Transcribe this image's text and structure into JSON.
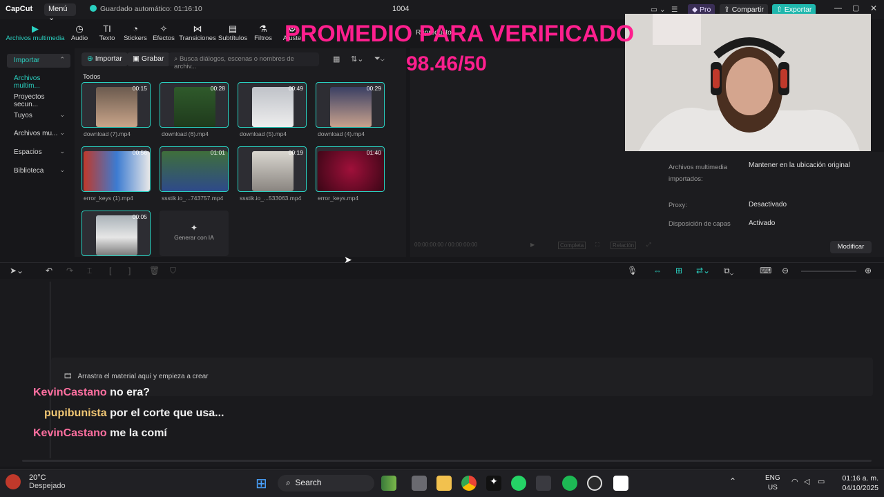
{
  "app": {
    "logo": "CapCut",
    "menu_label": "Menú",
    "autosave": "Guardado automático: 01:16:10",
    "project_name": "1004",
    "pro_label": "Pro",
    "share_label": "Compartir",
    "export_label": "Exportar"
  },
  "toolbar": {
    "items": [
      {
        "label": "Archivos multimedia",
        "icon": "media-icon"
      },
      {
        "label": "Audio",
        "icon": "audio-icon"
      },
      {
        "label": "Texto",
        "icon": "text-icon"
      },
      {
        "label": "Stickers",
        "icon": "sticker-icon"
      },
      {
        "label": "Efectos",
        "icon": "effects-icon"
      },
      {
        "label": "Transiciones",
        "icon": "transitions-icon"
      },
      {
        "label": "Subtítulos",
        "icon": "captions-icon"
      },
      {
        "label": "Filtros",
        "icon": "filters-icon"
      },
      {
        "label": "Ajuste",
        "icon": "adjust-icon"
      }
    ]
  },
  "leftnav": {
    "items": [
      {
        "label": "Importar"
      },
      {
        "label": "Archivos multim..."
      },
      {
        "label": "Proyectos secun..."
      },
      {
        "label": "Tuyos"
      },
      {
        "label": "Archivos mu..."
      },
      {
        "label": "Espacios"
      },
      {
        "label": "Biblioteca"
      }
    ]
  },
  "media": {
    "import_label": "Importar",
    "record_label": "Grabar",
    "search_placeholder": "Busca diálogos, escenas o nombres de archiv...",
    "section_label": "Todos",
    "generate_label": "Generar con IA",
    "clips": [
      {
        "name": "download (7).mp4",
        "duration": "00:15"
      },
      {
        "name": "download (6).mp4",
        "duration": "00:28"
      },
      {
        "name": "download (5).mp4",
        "duration": "00:49"
      },
      {
        "name": "download (4).mp4",
        "duration": "00:29"
      },
      {
        "name": "error_keys (1).mp4",
        "duration": "00:56"
      },
      {
        "name": "ssstik.io_...743757.mp4",
        "duration": "01:01"
      },
      {
        "name": "ssstik.io_...533063.mp4",
        "duration": "00:19"
      },
      {
        "name": "error_keys.mp4",
        "duration": "01:40"
      },
      {
        "name": "",
        "duration": "00:05"
      }
    ]
  },
  "player": {
    "title": "Reproductor",
    "time": "00:00:00:00 / 00:00:00:00",
    "complete_label": "Completa",
    "ratio_label": "Relación"
  },
  "props": {
    "rows": [
      {
        "key": "Archivos multimedia importados:",
        "value": "Mantener en la ubicación original"
      },
      {
        "key": "Proxy:",
        "value": "Desactivado"
      },
      {
        "key": "Disposición de capas",
        "value": "Activado"
      }
    ],
    "modify_label": "Modificar"
  },
  "overlay": {
    "line1": "PROMEDIO PARA VERIFICADO",
    "line2": "98.46/50"
  },
  "timeline": {
    "drop_text": "Arrastra el material aquí y empieza a crear"
  },
  "chat": [
    {
      "user": "KevinCastano",
      "message": "no era?"
    },
    {
      "user": "pupibunista",
      "message": "por el corte que usa..."
    },
    {
      "user": "KevinCastano",
      "message": "me la comí"
    }
  ],
  "taskbar": {
    "temp": "20°C",
    "weather": "Despejado",
    "search_label": "Search",
    "lang": "ENG",
    "region": "US",
    "time": "01:16 a. m.",
    "date": "04/10/2025"
  },
  "colors": {
    "accent": "#2ad0c0",
    "overlay": "#ff1f8e"
  }
}
